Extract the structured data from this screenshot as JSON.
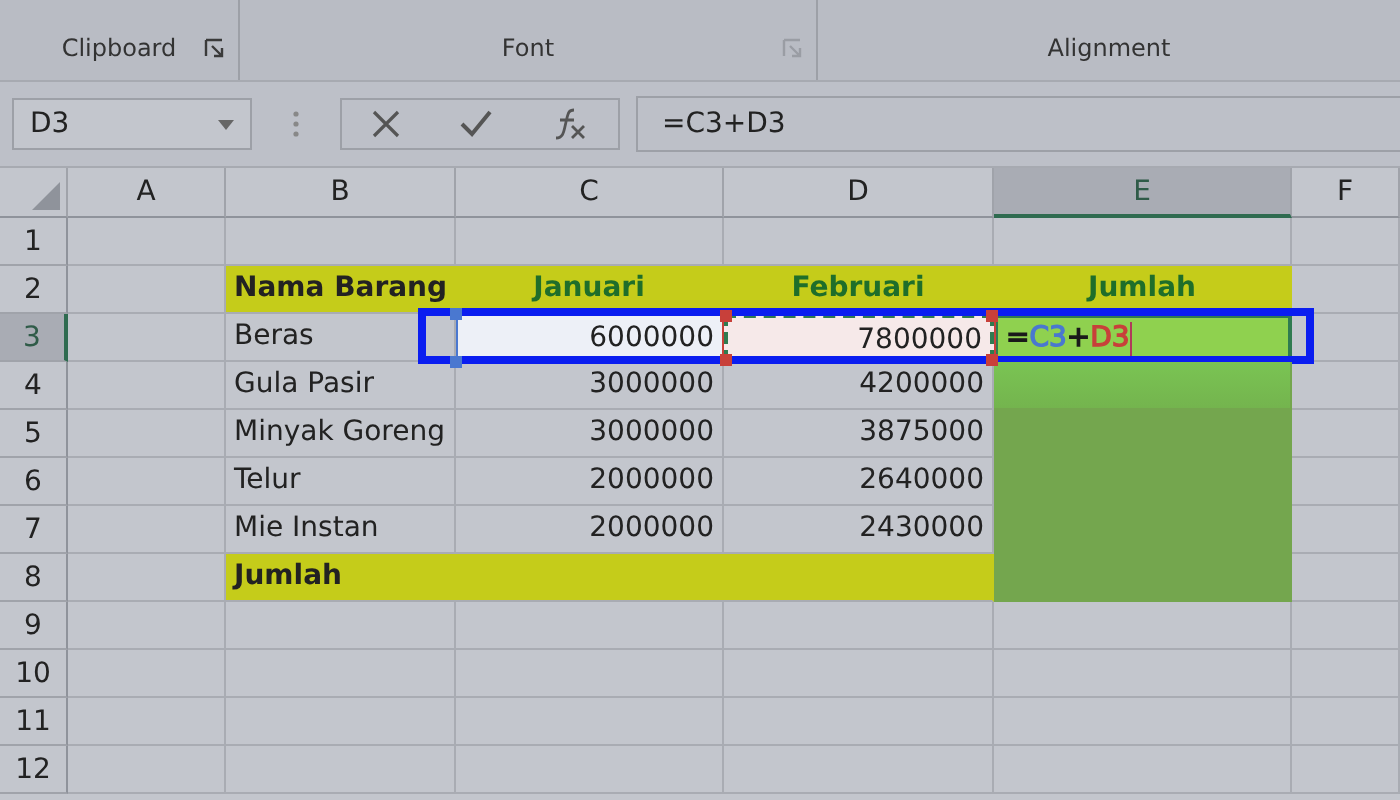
{
  "ribbon": {
    "groups": [
      {
        "label": "Clipboard",
        "launcher": {
          "disabled": false
        }
      },
      {
        "label": "Font",
        "launcher": {
          "disabled": true
        }
      },
      {
        "label": "Alignment"
      }
    ]
  },
  "formula_bar": {
    "name_box": "D3",
    "formula": "=C3+D3"
  },
  "columns": [
    {
      "label": "A",
      "selected": false
    },
    {
      "label": "B",
      "selected": false
    },
    {
      "label": "C",
      "selected": false
    },
    {
      "label": "D",
      "selected": false
    },
    {
      "label": "E",
      "selected": true
    },
    {
      "label": "F",
      "selected": false
    }
  ],
  "rows": [
    {
      "number": "1",
      "kind": "blank",
      "selected": false
    },
    {
      "number": "2",
      "kind": "header",
      "selected": false,
      "cells": [
        "Nama Barang",
        "Januari",
        "Februari",
        "Jumlah"
      ]
    },
    {
      "number": "3",
      "kind": "edit",
      "selected": true,
      "item": "Beras",
      "jan": "6000000",
      "feb": "7800000",
      "formula": [
        {
          "text": "=",
          "kind": "operator"
        },
        {
          "text": "C3",
          "kind": "reference",
          "color": "#4a78d0"
        },
        {
          "text": "+",
          "kind": "operator"
        },
        {
          "text": "D3",
          "kind": "reference",
          "color": "#c8403a"
        }
      ]
    },
    {
      "number": "4",
      "kind": "data",
      "selected": false,
      "item": "Gula Pasir",
      "jan": "3000000",
      "feb": "4200000"
    },
    {
      "number": "5",
      "kind": "data",
      "selected": false,
      "item": "Minyak Goreng",
      "jan": "3000000",
      "feb": "3875000"
    },
    {
      "number": "6",
      "kind": "data",
      "selected": false,
      "item": "Telur",
      "jan": "2000000",
      "feb": "2640000"
    },
    {
      "number": "7",
      "kind": "data",
      "selected": false,
      "item": "Mie Instan",
      "jan": "2000000",
      "feb": "2430000"
    },
    {
      "number": "8",
      "kind": "total",
      "selected": false,
      "item": "Jumlah"
    },
    {
      "number": "9",
      "kind": "blank",
      "selected": false
    },
    {
      "number": "10",
      "kind": "blank",
      "selected": false
    },
    {
      "number": "11",
      "kind": "blank",
      "selected": false
    },
    {
      "number": "12",
      "kind": "blank",
      "selected": false
    }
  ]
}
